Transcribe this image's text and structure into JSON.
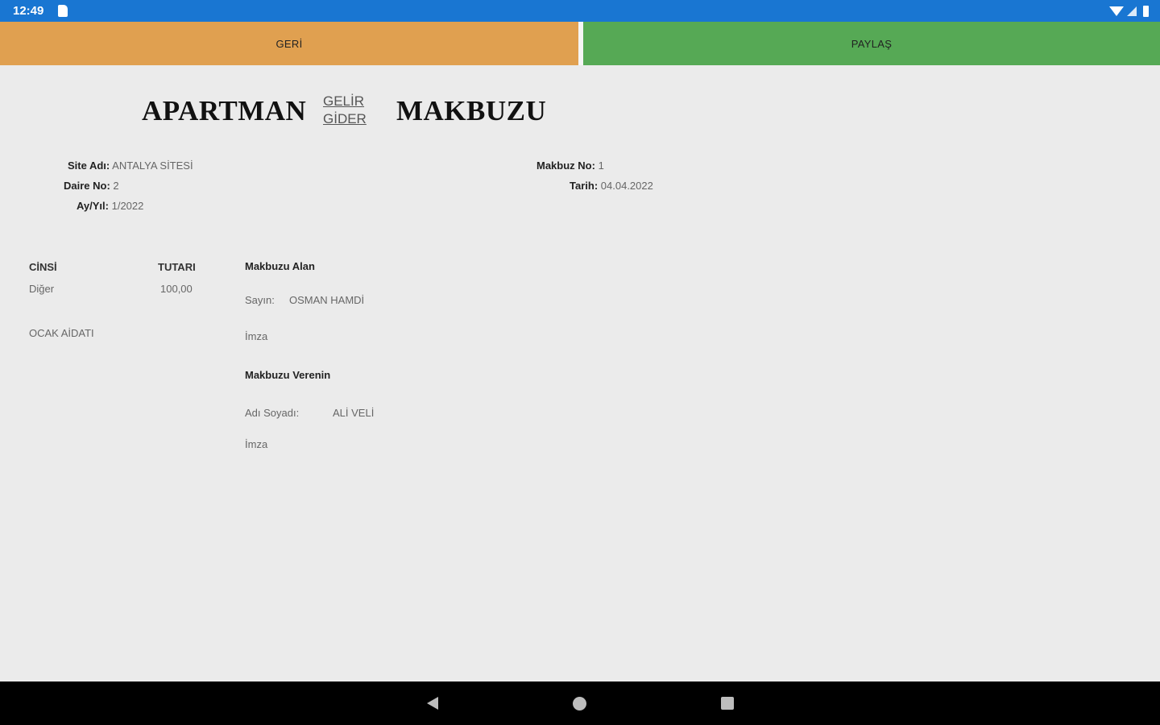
{
  "status_bar": {
    "time": "12:49"
  },
  "toolbar": {
    "back_label": "GERİ",
    "share_label": "PAYLAŞ"
  },
  "receipt": {
    "title_left": "APARTMAN",
    "title_right": "MAKBUZU",
    "type_options": [
      "GELİR",
      "GİDER"
    ],
    "site_label": "Site Adı:",
    "site_value": "ANTALYA SİTESİ",
    "daire_label": "Daire No:",
    "daire_value": "2",
    "ay_yil_label": "Ay/Yıl:",
    "ay_yil_value": "1/2022",
    "makbuz_no_label": "Makbuz No:",
    "makbuz_no_value": "1",
    "tarih_label": "Tarih:",
    "tarih_value": "04.04.2022",
    "columns": {
      "cinsi": "CİNSİ",
      "tutari": "TUTARI"
    },
    "item": {
      "cinsi": "Diğer",
      "tutari": "100,00",
      "description": "OCAK AİDATI"
    },
    "receiver": {
      "heading": "Makbuzu Alan",
      "sayin_label": "Sayın:",
      "sayin_value": "OSMAN HAMDİ",
      "imza_label": "İmza"
    },
    "giver": {
      "heading": "Makbuzu Verenin",
      "adsoyad_label": "Adı Soyadı:",
      "adsoyad_value": "ALİ VELİ",
      "imza_label": "İmza"
    }
  },
  "nav_bar": {
    "icons": [
      "back-icon",
      "home-icon",
      "recents-icon"
    ]
  },
  "colors": {
    "status_bar": "#1976d2",
    "back_button": "#e0a050",
    "share_button": "#56a955",
    "background": "#ebebeb"
  }
}
